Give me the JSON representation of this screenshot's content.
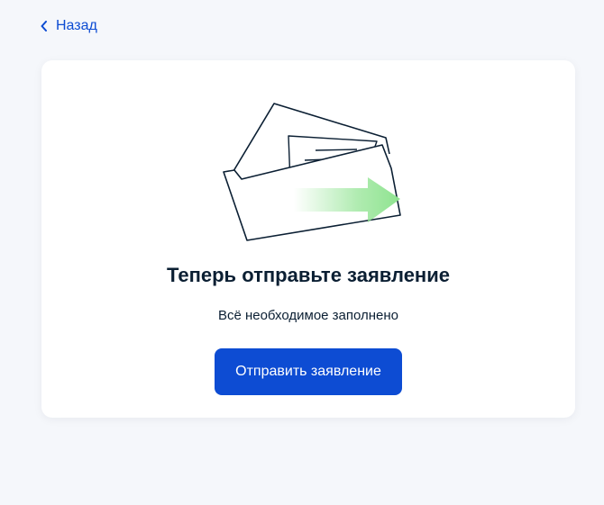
{
  "nav": {
    "back_label": "Назад"
  },
  "card": {
    "title": "Теперь отправьте заявление",
    "subtitle": "Всё необходимое заполнено",
    "submit_label": "Отправить заявление"
  },
  "icons": {
    "back": "chevron-left-icon",
    "illustration": "envelope-send-icon"
  },
  "colors": {
    "accent": "#0d4cd3",
    "arrow": "#8ee38f",
    "background": "#f5f7fb",
    "text": "#0b1f33"
  }
}
